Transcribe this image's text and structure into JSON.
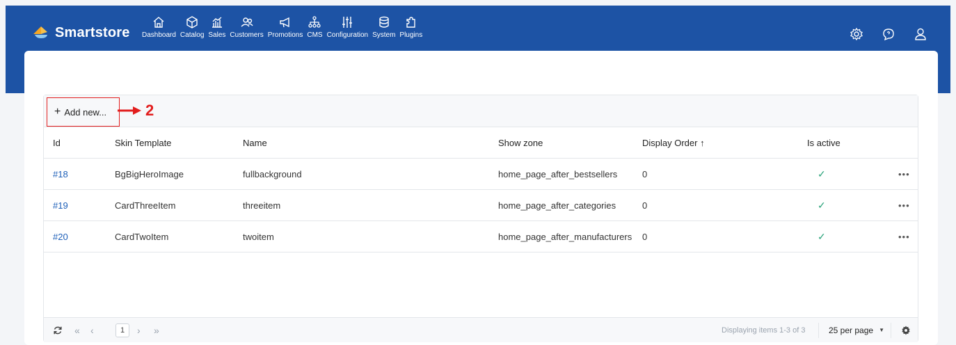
{
  "brand": {
    "name": "Smartstore"
  },
  "nav": [
    {
      "label": "Dashboard",
      "icon": "home-icon"
    },
    {
      "label": "Catalog",
      "icon": "cube-icon"
    },
    {
      "label": "Sales",
      "icon": "chart-icon"
    },
    {
      "label": "Customers",
      "icon": "users-icon"
    },
    {
      "label": "Promotions",
      "icon": "megaphone-icon"
    },
    {
      "label": "CMS",
      "icon": "sitemap-icon"
    },
    {
      "label": "Configuration",
      "icon": "sliders-icon"
    },
    {
      "label": "System",
      "icon": "database-icon"
    },
    {
      "label": "Plugins",
      "icon": "puzzle-icon"
    }
  ],
  "toolbar": {
    "add_label": "Add new...",
    "annotation_number": "2"
  },
  "table": {
    "headers": {
      "id": "Id",
      "skin": "Skin Template",
      "name": "Name",
      "zone": "Show zone",
      "order": "Display Order ↑",
      "active": "Is active"
    },
    "rows": [
      {
        "id": "#18",
        "skin": "BgBigHeroImage",
        "name": "fullbackground",
        "zone": "home_page_after_bestsellers",
        "order": "0",
        "active": true
      },
      {
        "id": "#19",
        "skin": "CardThreeItem",
        "name": "threeitem",
        "zone": "home_page_after_categories",
        "order": "0",
        "active": true
      },
      {
        "id": "#20",
        "skin": "CardTwoItem",
        "name": "twoitem",
        "zone": "home_page_after_manufacturers",
        "order": "0",
        "active": true
      }
    ]
  },
  "pager": {
    "first": "«",
    "prev": "‹",
    "page": "1",
    "next": "›",
    "last": "»",
    "display": "Displaying items 1-3 of 3",
    "per_page": "25 per page"
  },
  "colors": {
    "header_bg": "#1d53a5",
    "link": "#1d5fb8",
    "check": "#2aa37a",
    "annotation": "#e21d1d"
  }
}
